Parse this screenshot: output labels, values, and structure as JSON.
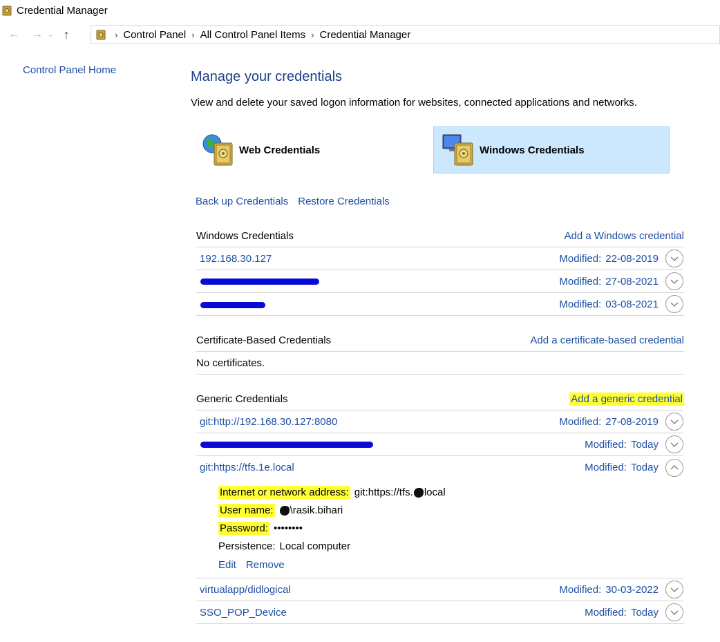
{
  "window": {
    "title": "Credential Manager"
  },
  "breadcrumb": [
    "Control Panel",
    "All Control Panel Items",
    "Credential Manager"
  ],
  "sidebar": {
    "home_link": "Control Panel Home"
  },
  "main": {
    "heading": "Manage your credentials",
    "subtitle": "View and delete your saved logon information for websites, connected applications and networks.",
    "tabs": [
      {
        "label": "Web Credentials",
        "selected": false
      },
      {
        "label": "Windows Credentials",
        "selected": true
      }
    ],
    "backup_link": "Back up Credentials",
    "restore_link": "Restore Credentials"
  },
  "windows_section": {
    "title": "Windows Credentials",
    "add_label": "Add a Windows credential",
    "items": [
      {
        "name": "192.168.30.127",
        "modified_label": "Modified:",
        "modified": "22-08-2019"
      },
      {
        "name": "",
        "modified_label": "Modified:",
        "modified": "27-08-2021"
      },
      {
        "name": "",
        "modified_label": "Modified:",
        "modified": "03-08-2021"
      }
    ]
  },
  "cert_section": {
    "title": "Certificate-Based Credentials",
    "add_label": "Add a certificate-based credential",
    "empty_text": "No certificates."
  },
  "generic_section": {
    "title": "Generic Credentials",
    "add_label": "Add a generic credential",
    "items": [
      {
        "name": "git:http://192.168.30.127:8080",
        "modified_label": "Modified:",
        "modified": "27-08-2019"
      },
      {
        "name": "",
        "modified_label": "Modified:",
        "modified": "Today"
      },
      {
        "name": "git:https://tfs.1e.local",
        "modified_label": "Modified:",
        "modified": "Today"
      },
      {
        "name": "virtualapp/didlogical",
        "modified_label": "Modified:",
        "modified": "30-03-2022"
      },
      {
        "name": "SSO_POP_Device",
        "modified_label": "Modified:",
        "modified": "Today"
      }
    ],
    "expanded_detail": {
      "address_label": "Internet or network address:",
      "address_prefix": "git:https://tfs.",
      "address_suffix": "local",
      "username_label": "User name:",
      "username_value": "\\rasik.bihari",
      "password_label": "Password:",
      "password_value": "••••••••",
      "persistence_label": "Persistence:",
      "persistence_value": "Local computer",
      "edit_label": "Edit",
      "remove_label": "Remove"
    }
  },
  "colors": {
    "link": "#1d4ea3",
    "heading": "#1e3f8a",
    "selected_tile": "#cce8ff",
    "highlight": "#ffff33",
    "redaction": "#0a0ad8"
  }
}
